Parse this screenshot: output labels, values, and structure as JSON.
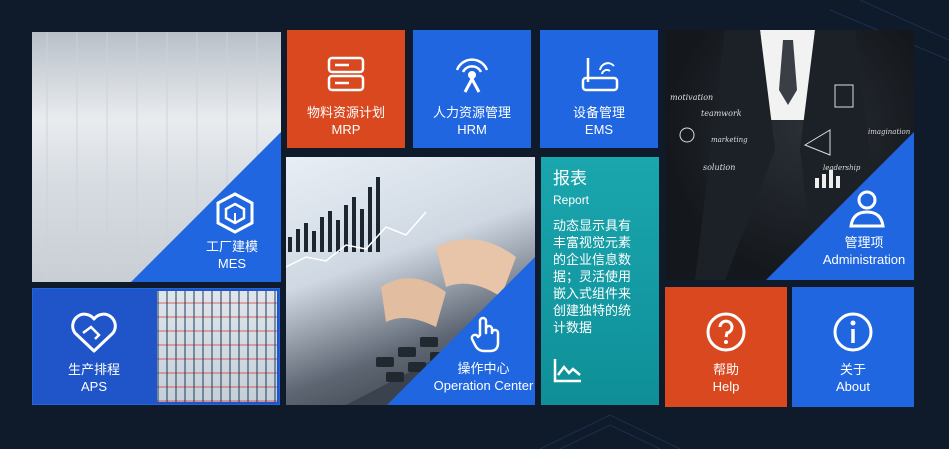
{
  "tiles": {
    "mes": {
      "title": "工厂建模",
      "subtitle": "MES"
    },
    "mrp": {
      "title": "物料资源计划",
      "subtitle": "MRP"
    },
    "hrm": {
      "title": "人力资源管理",
      "subtitle": "HRM"
    },
    "ems": {
      "title": "设备管理",
      "subtitle": "EMS"
    },
    "admin": {
      "title": "管理项",
      "subtitle": "Administration"
    },
    "aps": {
      "title": "生产排程",
      "subtitle": "APS"
    },
    "operation": {
      "title": "操作中心",
      "subtitle": "Operation Center"
    },
    "report": {
      "title": "报表",
      "subtitle": "Report",
      "description": "动态显示具有丰富视觉元素的企业信息数据；灵活使用嵌入式组件来创建独特的统计数据"
    },
    "help": {
      "title": "帮助",
      "subtitle": "Help"
    },
    "about": {
      "title": "关于",
      "subtitle": "About"
    }
  },
  "business_photo_words": [
    "motivation",
    "teamwork",
    "marketing",
    "solution",
    "imagination",
    "leadership"
  ],
  "colors": {
    "background": "#0f1a2b",
    "blue": "#1f66e0",
    "orange": "#d9481f",
    "teal": "#14a0a8"
  },
  "icons": {
    "mes": "hexagon-cube-icon",
    "mrp": "server-icon",
    "hrm": "broadcast-person-icon",
    "ems": "router-icon",
    "admin": "user-icon",
    "aps": "handshake-heart-icon",
    "operation": "touch-hand-icon",
    "report": "chart-line-icon",
    "help": "question-icon",
    "about": "info-icon"
  }
}
